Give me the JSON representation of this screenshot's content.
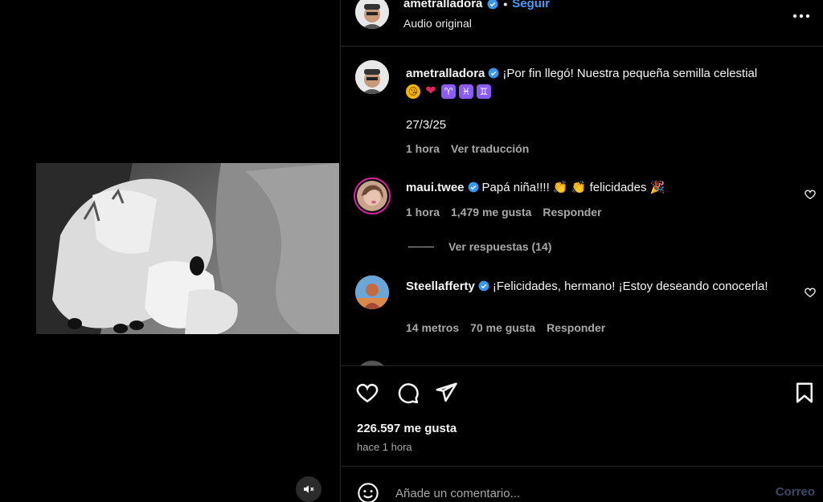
{
  "header": {
    "username": "ametralladora",
    "separator": "•",
    "follow_label": "Seguir",
    "audio_label": "Audio original",
    "more_icon": "more-horizontal-icon"
  },
  "caption": {
    "username": "ametralladora",
    "text": "¡Por fin llegó! Nuestra pequeña semilla celestial",
    "emojis": [
      "😘",
      "❤",
      "♈",
      "♓",
      "♊"
    ],
    "date_line": "27/3/25",
    "time": "1 hora",
    "translate_label": "Ver traducción"
  },
  "comments": [
    {
      "username": "maui.twee",
      "text": "Papá niña!!!! 👏 👏 felicidades 🎉",
      "time": "1 hora",
      "likes": "1,479 me gusta",
      "reply_label": "Responder",
      "view_replies": "Ver respuestas (14)"
    },
    {
      "username": "Steellafferty",
      "text": "¡Felicidades, hermano! ¡Estoy deseando conocerla!",
      "time": "14 metros",
      "likes": "70 me gusta",
      "reply_label": "Responder"
    }
  ],
  "actions": {
    "likes_count": "226.597 me gusta",
    "time_ago": "hace 1 hora"
  },
  "comment_bar": {
    "placeholder": "Añade un comentario...",
    "post_label": "Correo"
  },
  "colors": {
    "background": "#000000",
    "link": "#4a9cf5",
    "secondary_text": "#a8a8a8",
    "divider": "#262626"
  }
}
